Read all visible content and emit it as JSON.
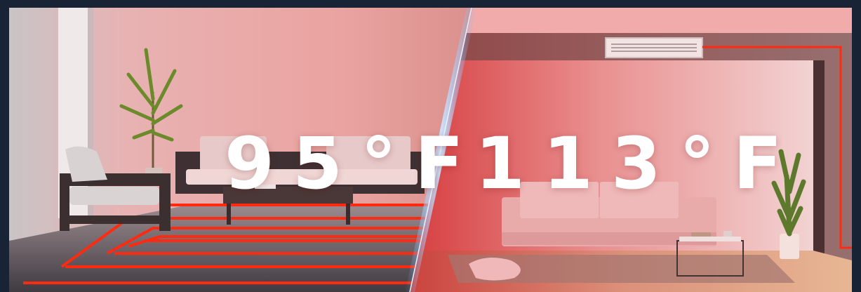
{
  "comparison": {
    "left": {
      "label": "95°F",
      "heating": "floor-heating-lines"
    },
    "right": {
      "label": "113°F",
      "heating": "ceiling-air-vent"
    }
  },
  "colors": {
    "frame": "#182436",
    "heat_line": "#ff2a10",
    "right_tint": "#e23b3b",
    "divider_glow": "#6fb4ff"
  }
}
